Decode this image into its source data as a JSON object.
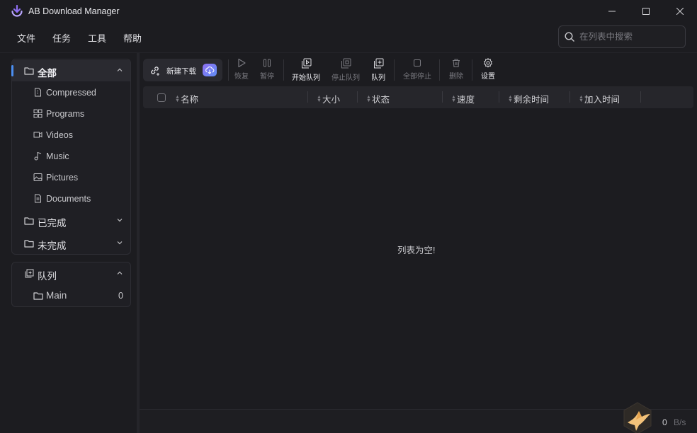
{
  "app": {
    "title": "AB Download Manager"
  },
  "menu": [
    "文件",
    "任务",
    "工具",
    "帮助"
  ],
  "search": {
    "placeholder": "在列表中搜索"
  },
  "sidebar": {
    "categories": {
      "all_label": "全部",
      "items": [
        {
          "label": "Compressed",
          "icon": "file-zip-icon"
        },
        {
          "label": "Programs",
          "icon": "grid-icon"
        },
        {
          "label": "Videos",
          "icon": "video-icon"
        },
        {
          "label": "Music",
          "icon": "music-icon"
        },
        {
          "label": "Pictures",
          "icon": "image-icon"
        },
        {
          "label": "Documents",
          "icon": "document-icon"
        }
      ],
      "completed_label": "已完成",
      "unfinished_label": "未完成"
    },
    "queues": {
      "label": "队列",
      "items": [
        {
          "label": "Main",
          "count": "0"
        }
      ]
    }
  },
  "toolbar": {
    "new_download": "新建下载",
    "resume": "恢复",
    "pause": "暂停",
    "start_queue": "开始队列",
    "stop_queue": "停止队列",
    "queue": "队列",
    "stop_all": "全部停止",
    "delete": "删除",
    "settings": "设置"
  },
  "table": {
    "columns": [
      "名称",
      "大小",
      "状态",
      "速度",
      "剩余时间",
      "加入时间"
    ],
    "empty_message": "列表为空!"
  },
  "status": {
    "speed_value": "0",
    "speed_unit": "B/s"
  },
  "colors": {
    "accent": "#4b8ef0",
    "background": "#1c1c20",
    "panel": "#1f1f24",
    "brand_purple": "#8f6ff2"
  }
}
